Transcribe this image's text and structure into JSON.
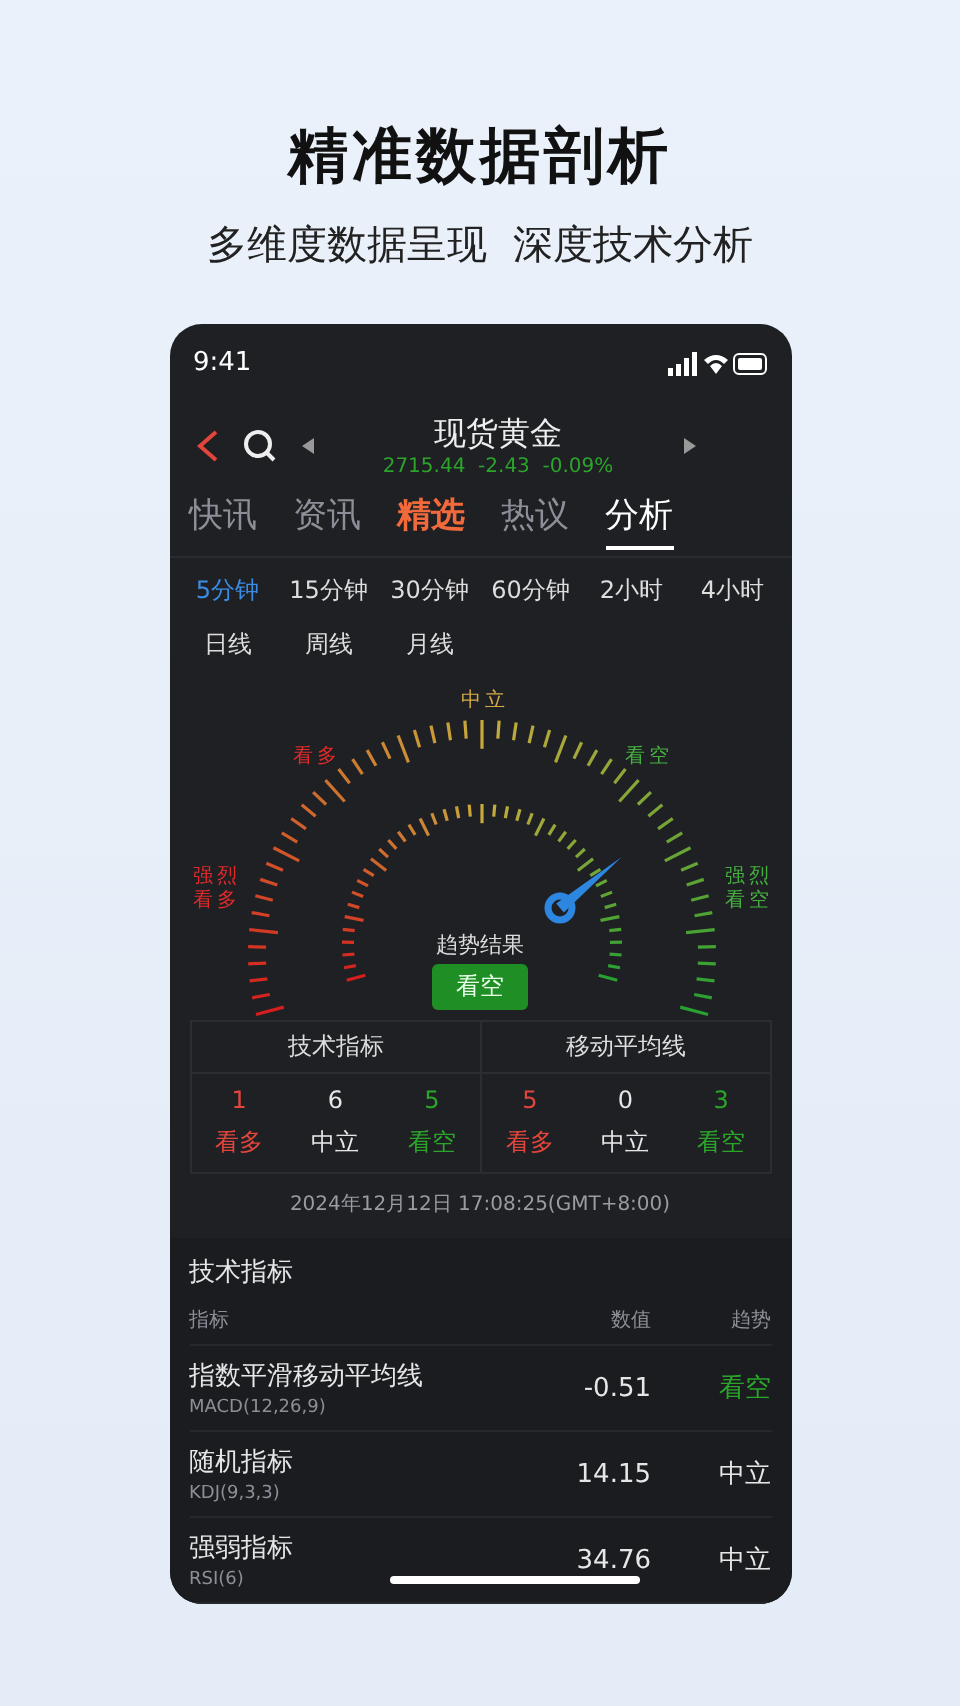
{
  "headline": "精准数据剖析",
  "subheadline": "多维度数据呈现  深度技术分析",
  "status_bar": {
    "time": "9:41"
  },
  "header": {
    "title": "现货黄金",
    "quote": "2715.44  -2.43  -0.09%"
  },
  "tabs": [
    {
      "label": "快讯",
      "selected": false,
      "kind": "plain"
    },
    {
      "label": "资讯",
      "selected": false,
      "kind": "plain"
    },
    {
      "label": "精选",
      "selected": false,
      "kind": "highlight"
    },
    {
      "label": "热议",
      "selected": false,
      "kind": "plain"
    },
    {
      "label": "分析",
      "selected": true,
      "kind": "plain"
    }
  ],
  "timeframes": [
    {
      "label": "5分钟",
      "selected": true
    },
    {
      "label": "15分钟",
      "selected": false
    },
    {
      "label": "30分钟",
      "selected": false
    },
    {
      "label": "60分钟",
      "selected": false
    },
    {
      "label": "2小时",
      "selected": false
    },
    {
      "label": "4小时",
      "selected": false
    },
    {
      "label": "日线",
      "selected": false
    },
    {
      "label": "周线",
      "selected": false
    },
    {
      "label": "月线",
      "selected": false
    }
  ],
  "gauge": {
    "labels": {
      "strong_bull": "强烈看多",
      "bull": "看多",
      "neutral": "中立",
      "bear": "看空",
      "strong_bear": "强烈看空"
    },
    "result_label": "趋势结果",
    "result": {
      "text": "看空",
      "kind": "bear"
    }
  },
  "summary": [
    {
      "title": "技术指标",
      "counts": [
        {
          "value": "1",
          "label": "看多",
          "kind": "bull"
        },
        {
          "value": "6",
          "label": "中立",
          "kind": "neutral"
        },
        {
          "value": "5",
          "label": "看空",
          "kind": "bear"
        }
      ]
    },
    {
      "title": "移动平均线",
      "counts": [
        {
          "value": "5",
          "label": "看多",
          "kind": "bull"
        },
        {
          "value": "0",
          "label": "中立",
          "kind": "neutral"
        },
        {
          "value": "3",
          "label": "看空",
          "kind": "bear"
        }
      ]
    }
  ],
  "timestamp": "2024年12月12日 17:08:25(GMT+8:00)",
  "indicators": {
    "title": "技术指标",
    "columns": [
      "指标",
      "数值",
      "趋势"
    ],
    "rows": [
      {
        "name": "指数平滑移动平均线",
        "code": "MACD(12,26,9)",
        "value": "-0.51",
        "trend": "看空",
        "kind": "bear"
      },
      {
        "name": "随机指标",
        "code": "KDJ(9,3,3)",
        "value": "14.15",
        "trend": "中立",
        "kind": "neutral"
      },
      {
        "name": "强弱指标",
        "code": "RSI(6)",
        "value": "34.76",
        "trend": "中立",
        "kind": "neutral"
      }
    ]
  }
}
